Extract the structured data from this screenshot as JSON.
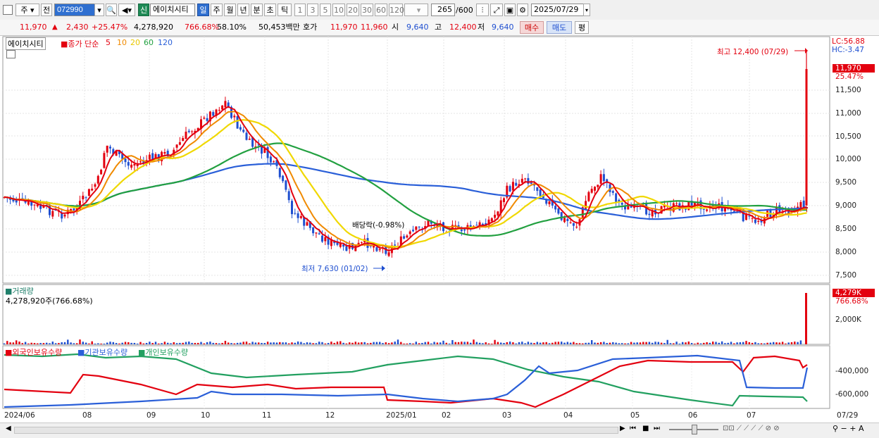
{
  "toolbar": {
    "period_jo": "주",
    "jeon": "전",
    "code": "072990",
    "sin": "신",
    "stock_name": "에이치시티",
    "tf_il": "일",
    "tf_ju": "주",
    "tf_wol": "월",
    "tf_nyeon": "년",
    "tf_bun": "분",
    "tf_cho": "초",
    "tf_tik": "틱",
    "intervals": [
      "1",
      "3",
      "5",
      "10",
      "20",
      "30",
      "60",
      "120"
    ],
    "count_value": "265",
    "count_total": "/600",
    "date": "2025/07/29"
  },
  "quote": {
    "price": "11,970",
    "arrow": "▲",
    "change": "2,430",
    "change_pct": "+25.47%",
    "volume": "4,278,920",
    "vol_ratio": "766.68%",
    "turnover": "58.10%",
    "amount": "50,453백만",
    "hoga_label": "호가",
    "ask": "11,970",
    "bid": "11,960",
    "open_label": "시",
    "open": "9,640",
    "high_label": "고",
    "high": "12,400",
    "low_label": "저",
    "low": "9,640",
    "buy": "매수",
    "sell": "매도",
    "avg": "평"
  },
  "price_panel": {
    "title": "에이치시티",
    "ma_label": "종가 단순",
    "ma_periods": [
      "5",
      "10",
      "20",
      "60",
      "120"
    ],
    "ma_colors": [
      "#e3000f",
      "#f08a00",
      "#f0d800",
      "#22a040",
      "#2a5fd8"
    ],
    "lc": "LC:56.88",
    "hc": "HC:-3.47",
    "high_annot": "최고 12,400 (07/29)",
    "low_annot": "최저 7,630 (01/02)",
    "div_annot": "배당락(-0.98%)",
    "last_price_tag": "11,970",
    "last_pct": "25.47%",
    "y_ticks": [
      "11,500",
      "11,000",
      "10,500",
      "10,000",
      "9,500",
      "9,000",
      "8,500",
      "8,000",
      "7,500"
    ]
  },
  "volume_panel": {
    "title": "거래량",
    "value": "4,278,920주(766.68%)",
    "tag": "4,279K",
    "pct": "766.68%",
    "y_tick": "2,000K"
  },
  "holdings_panel": {
    "series": [
      "외국인보유수량",
      "기관보유수량",
      "개인보유수량"
    ],
    "series_colors": [
      "#e3000f",
      "#2a5fd8",
      "#22a060"
    ],
    "y_ticks": [
      "-400,000",
      "-600,000"
    ]
  },
  "x_axis": [
    "2024/06",
    "08",
    "09",
    "10",
    "11",
    "12",
    "2025/01",
    "02",
    "03",
    "04",
    "05",
    "06",
    "07",
    "07/29"
  ]
}
